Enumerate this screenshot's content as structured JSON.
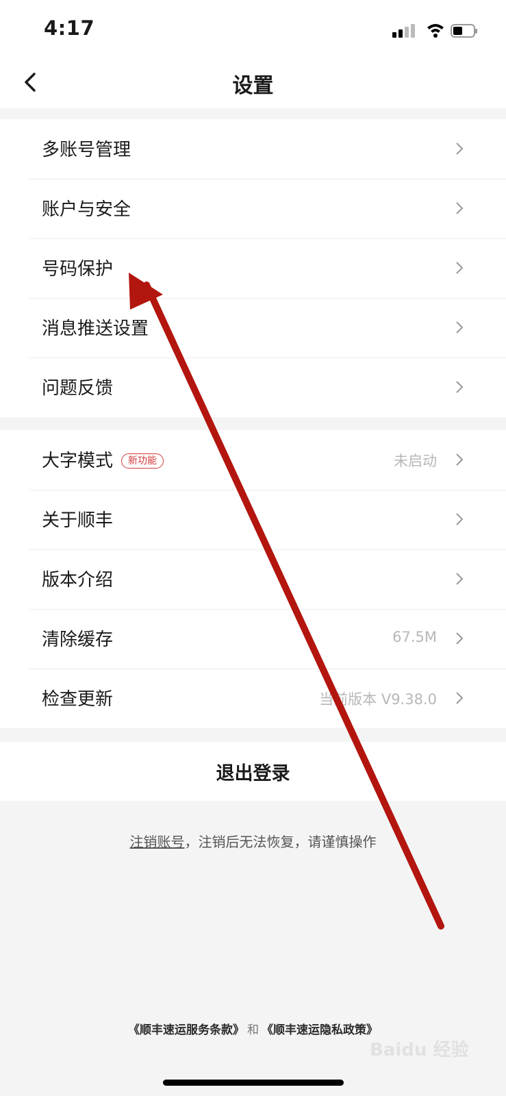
{
  "status": {
    "time": "4:17"
  },
  "nav": {
    "title": "设置"
  },
  "group1": [
    {
      "label": "多账号管理",
      "value": ""
    },
    {
      "label": "账户与安全",
      "value": ""
    },
    {
      "label": "号码保护",
      "value": ""
    },
    {
      "label": "消息推送设置",
      "value": ""
    },
    {
      "label": "问题反馈",
      "value": ""
    }
  ],
  "group2": [
    {
      "label": "大字模式",
      "badge": "新功能",
      "value": "未启动"
    },
    {
      "label": "关于顺丰",
      "value": ""
    },
    {
      "label": "版本介绍",
      "value": ""
    },
    {
      "label": "清除缓存",
      "value": "67.5M"
    },
    {
      "label": "检查更新",
      "value": "当前版本 V9.38.0"
    }
  ],
  "logout": {
    "label": "退出登录"
  },
  "cancel": {
    "link": "注销账号",
    "text": "，注销后无法恢复，请谨慎操作"
  },
  "terms": {
    "service": "《顺丰速运服务条款》",
    "and": "和",
    "privacy": "《顺丰速运隐私政策》"
  },
  "watermark": "Baidu 经验",
  "colors": {
    "accent_red": "#d23a3a",
    "annotation_arrow": "#b3150f"
  }
}
